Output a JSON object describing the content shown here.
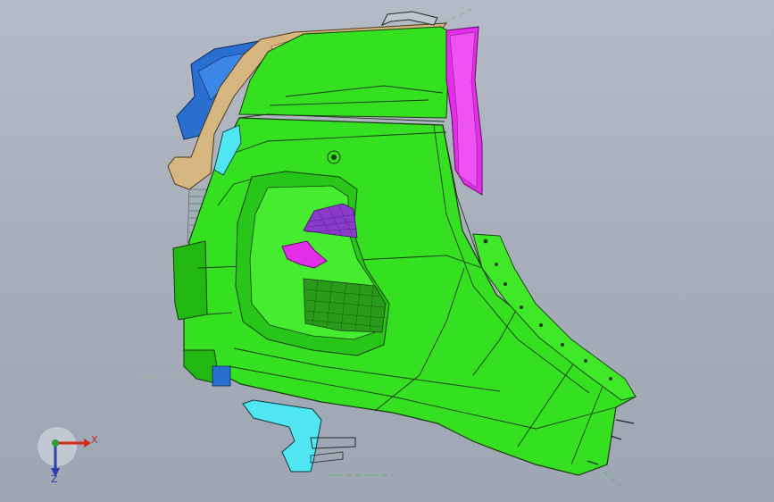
{
  "viewport": {
    "name": "cad-3d-viewport",
    "background_top": "#b5bbc6",
    "background_bottom": "#9ea6b3"
  },
  "model": {
    "name": "bumper-corner-assembly",
    "colors": {
      "main_body": "#34e020",
      "main_body_dark": "#22b812",
      "edge": "#1a3a10",
      "magenta_part": "#e22ee6",
      "blue_part": "#2a6fd0",
      "tan_part": "#d6b680",
      "cyan_part": "#4fe6f2",
      "mesh_purple": "#8a3cc8",
      "mesh_green": "#2a9a1a"
    }
  },
  "triad": {
    "x_label": "X",
    "z_label": "Z",
    "colors": {
      "x": "#d42a22",
      "y": "#2ca02c",
      "z": "#2a3fb0"
    }
  }
}
